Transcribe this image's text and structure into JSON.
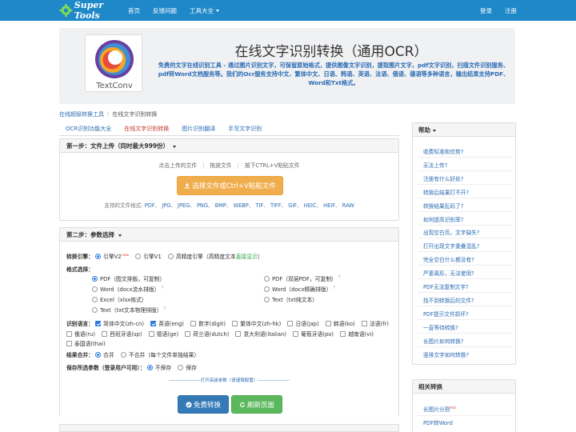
{
  "nav": {
    "logo_text": "Super Tools",
    "home": "首页",
    "feedback": "反馈问题",
    "tools": "工具大全",
    "login": "登录",
    "register": "注册"
  },
  "hero": {
    "logo_text": "TextConv",
    "title": "在线文字识别转换（通用OCR）",
    "description": "免费的文字在线识别工具 - 通过图片识别文字，可保留原始格式，提供图像文字识别，提取图片文字，pdf文字识别，扫描文件识别服务、pdf转Word文档服务等。我们的Ocr服务支持中文、繁体中文、日语、韩语、英语、法语、俄语、德语等多种语言，输出结果支持PDF、Word和Txt格式。"
  },
  "breadcrumb": {
    "parent": "在线超级转换工具",
    "separator": "/",
    "current": "在线文字识别转换"
  },
  "tabs": [
    {
      "label": "OCR识别功能大全",
      "active": false
    },
    {
      "label": "在线文字识别转换",
      "active": true
    },
    {
      "label": "图片识别翻译",
      "active": false
    },
    {
      "label": "手写文字识别",
      "active": false
    }
  ],
  "step1": {
    "title": "第一步：文件上传（同时最大999份）",
    "hint_click": "点击上传的文件",
    "hint_drag": "拖放文件",
    "hint_paste": "按下CTRL+V粘贴文件",
    "hint_sep": "|",
    "upload_button": "选择文件或Ctrl+V粘贴文件",
    "formats_label": "支持的文件格式:",
    "formats": [
      "PDF",
      "JPG",
      "JPEG",
      "PNG",
      "BMP",
      "WEBP",
      "TIF",
      "TIFF",
      "GIF",
      "HEIC",
      "HEIF",
      "RAW"
    ]
  },
  "step2": {
    "title": "第二步：参数选择",
    "engine_label": "转换引擎：",
    "engine_v2": "引擎V2",
    "engine_v2_badge": "new",
    "engine_v1": "引擎V1",
    "engine_hq": "高精度引擎（高精度文本",
    "engine_hq_link": "直接显示",
    "engine_hq_end": "）",
    "format_label": "格式选择：",
    "formats": [
      {
        "label": "PDF（图文排版，可复制）",
        "checked": true
      },
      {
        "label": "PDF（双层PDF，可复制）",
        "checked": false
      },
      {
        "label": "Word（docx流水排版）",
        "checked": false
      },
      {
        "label": "Word（docx精确排版）",
        "checked": false
      },
      {
        "label": "Excel（xlsx格式）",
        "checked": false
      },
      {
        "label": "Text（txt纯文本）",
        "checked": false
      },
      {
        "label": "Text（txt文本物理排版）",
        "checked": false
      }
    ],
    "lang_label": "识别语言：",
    "languages": [
      {
        "label": "简体中文(zh-cn)",
        "checked": true
      },
      {
        "label": "英语(eng)",
        "checked": true
      },
      {
        "label": "数字(digit)",
        "checked": false
      },
      {
        "label": "繁体中文(zh-hk)",
        "checked": false
      },
      {
        "label": "日语(jap)",
        "checked": false
      },
      {
        "label": "韩语(ko)",
        "checked": false
      },
      {
        "label": "法语(fr)",
        "checked": false
      },
      {
        "label": "俄语(ru)",
        "checked": false
      },
      {
        "label": "西班牙语(sp)",
        "checked": false
      },
      {
        "label": "德语(ge)",
        "checked": false
      },
      {
        "label": "荷兰语(dutch)",
        "checked": false
      },
      {
        "label": "意大利语(italian)",
        "checked": false
      },
      {
        "label": "葡萄牙语(po)",
        "checked": false
      },
      {
        "label": "越南语(vi)",
        "checked": false
      },
      {
        "label": "泰国语(thai)",
        "checked": false
      }
    ],
    "merge_label": "结果合并：",
    "merge_yes": "合并",
    "merge_no": "不合并（每个文件单独结果）",
    "save_label": "保存所选参数（登录用户可用）：",
    "save_no": "不保存",
    "save_yes": "保存",
    "advanced": "--------------------打开高级参数（请谨慎配置）--------------------",
    "btn_convert": "免费转换",
    "btn_refresh": "刷新页面"
  },
  "help": {
    "title": "帮助",
    "items": [
      "收费标准和优势?",
      "无法上传?",
      "注册有什么好处?",
      "转换后结果打不开?",
      "转换结果乱码了?",
      "如何提高识别率?",
      "出现空白页，文字缺失?",
      "打开出现文字重叠混乱?",
      "完全空白什么都没有?",
      "严重离形，无法使用?",
      "PDF无法复制文字?",
      "找不到转换后的文件?",
      "PDF提示文件损坏?",
      "一直等待转换?",
      "长图片如何转换?",
      "竖排文字如何转换?"
    ]
  },
  "related": {
    "title": "相关转换",
    "items": [
      "长图片分割",
      "PDF转Word"
    ],
    "hot_badge": "hot"
  }
}
